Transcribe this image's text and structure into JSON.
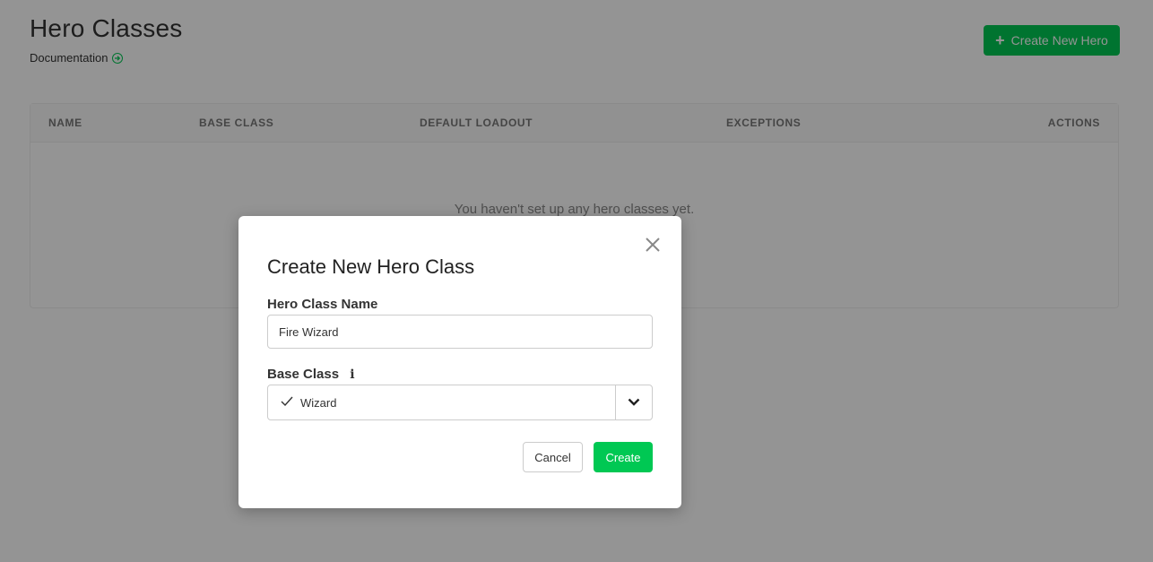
{
  "header": {
    "title": "Hero Classes",
    "doc_link": "Documentation",
    "create_button": "Create New Hero"
  },
  "table": {
    "columns": [
      "NAME",
      "BASE CLASS",
      "DEFAULT LOADOUT",
      "EXCEPTIONS",
      "ACTIONS"
    ],
    "empty_message": "You haven't set up any hero classes yet."
  },
  "modal": {
    "title": "Create New Hero Class",
    "name_label": "Hero Class Name",
    "name_value": "Fire Wizard",
    "base_class_label": "Base Class",
    "base_class_value": "Wizard",
    "cancel_label": "Cancel",
    "create_label": "Create"
  },
  "colors": {
    "accent": "#00c853",
    "overlay": "rgba(0,0,0,0.42)"
  },
  "icons": [
    "arrow-right-circle-icon",
    "plus-icon",
    "close-icon",
    "info-icon",
    "check-icon",
    "chevron-down-icon"
  ]
}
